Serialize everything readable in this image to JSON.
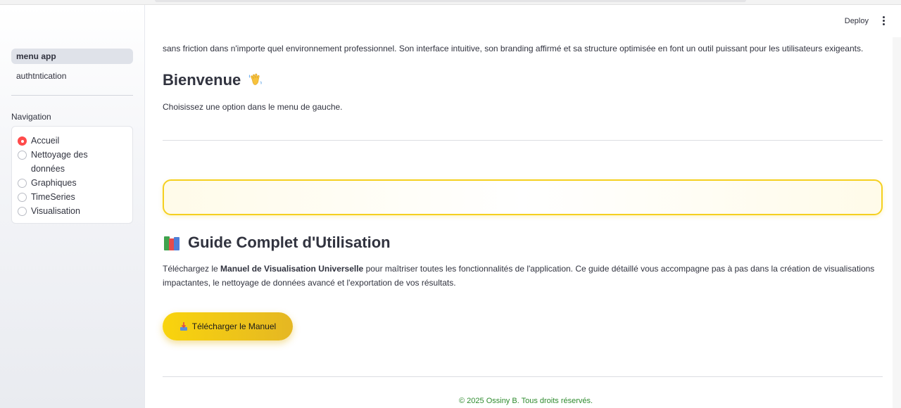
{
  "sidebar": {
    "pages": [
      {
        "label": "menu app",
        "active": true
      },
      {
        "label": "authtntication",
        "active": false
      }
    ],
    "nav_title": "Navigation",
    "radio_options": [
      {
        "label": "Accueil",
        "selected": true
      },
      {
        "label": "Nettoyage des données",
        "selected": false
      },
      {
        "label": "Graphiques",
        "selected": false
      },
      {
        "label": "TimeSeries",
        "selected": false
      },
      {
        "label": "Visualisation",
        "selected": false
      }
    ]
  },
  "header": {
    "deploy_label": "Deploy",
    "menu_icon": "kebab-menu-icon"
  },
  "main": {
    "intro_text": "sans friction dans n'importe quel environnement professionnel. Son interface intuitive, son branding affirmé et sa structure optimisée en font un outil puissant pour les utilisateurs exigeants.",
    "welcome_title": "Bienvenue",
    "welcome_icon": "waving-hand-icon",
    "choose_text": "Choisissez une option dans le menu de gauche.",
    "guide_title": "Guide Complet d'Utilisation",
    "guide_icon": "books-icon",
    "guide_para_prefix": "Téléchargez le ",
    "guide_para_bold": "Manuel de Visualisation Universelle",
    "guide_para_suffix": " pour maîtriser toutes les fonctionnalités de l'application. Ce guide détaillé vous accompagne pas à pas dans la création de visualisations impactantes, le nettoyage de données avancé et l'exportation de vos résultats.",
    "download_button": "Télécharger le Manuel",
    "download_icon": "inbox-tray-icon",
    "footer": "© 2025 Ossiny B. Tous droits réservés."
  },
  "colors": {
    "accent_red": "#ff4b4b",
    "yellow": "#f5d020",
    "footer_green": "#2e8b2e"
  }
}
